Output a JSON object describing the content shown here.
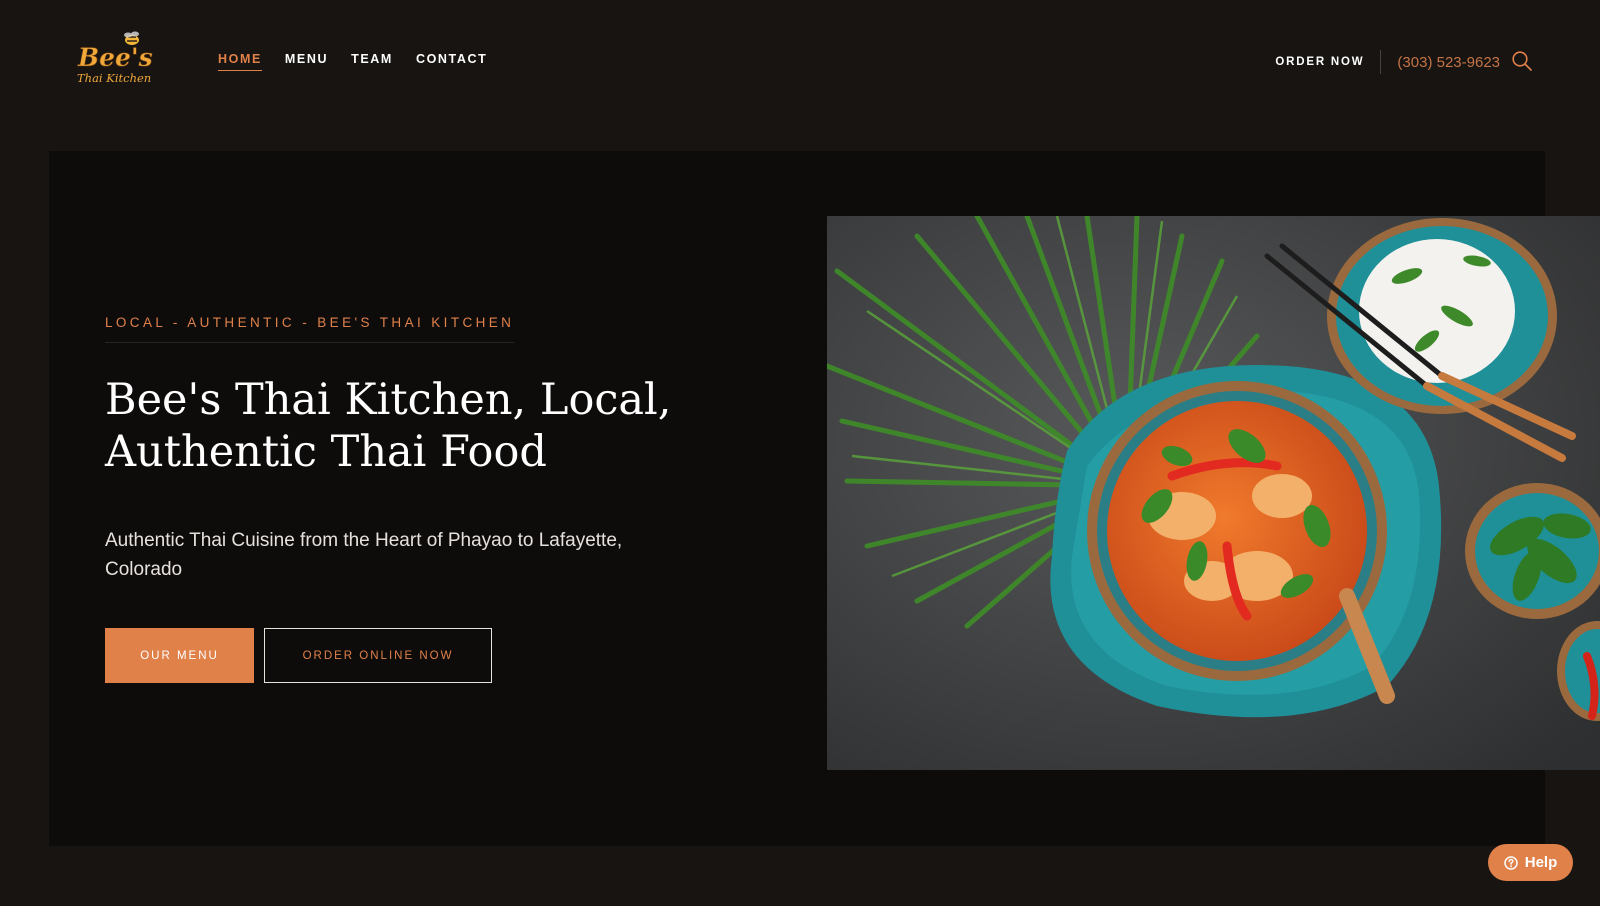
{
  "brand": {
    "logo_line1": "Bee's",
    "logo_line2": "Thai Kitchen"
  },
  "nav": {
    "items": [
      {
        "label": "HOME",
        "active": true
      },
      {
        "label": "MENU"
      },
      {
        "label": "TEAM"
      },
      {
        "label": "CONTACT"
      }
    ]
  },
  "header": {
    "order_label": "ORDER NOW",
    "phone": "(303) 523-9623",
    "search_icon": "search-icon"
  },
  "hero": {
    "eyebrow": "LOCAL - AUTHENTIC - BEE'S THAI KITCHEN",
    "title_line1": "Bee's Thai Kitchen, Local,",
    "title_line2": "Authentic Thai Food",
    "subtitle": "Authentic Thai Cuisine from the Heart of Phayao to Lafayette, Colorado",
    "primary_button": "OUR MENU",
    "secondary_button": "ORDER ONLINE NOW"
  },
  "help": {
    "label": "Help",
    "icon": "question-circle-icon"
  },
  "colors": {
    "accent": "#e0814a",
    "background": "#171411",
    "panel": "#0e0c0b",
    "phone": "#c57446"
  }
}
